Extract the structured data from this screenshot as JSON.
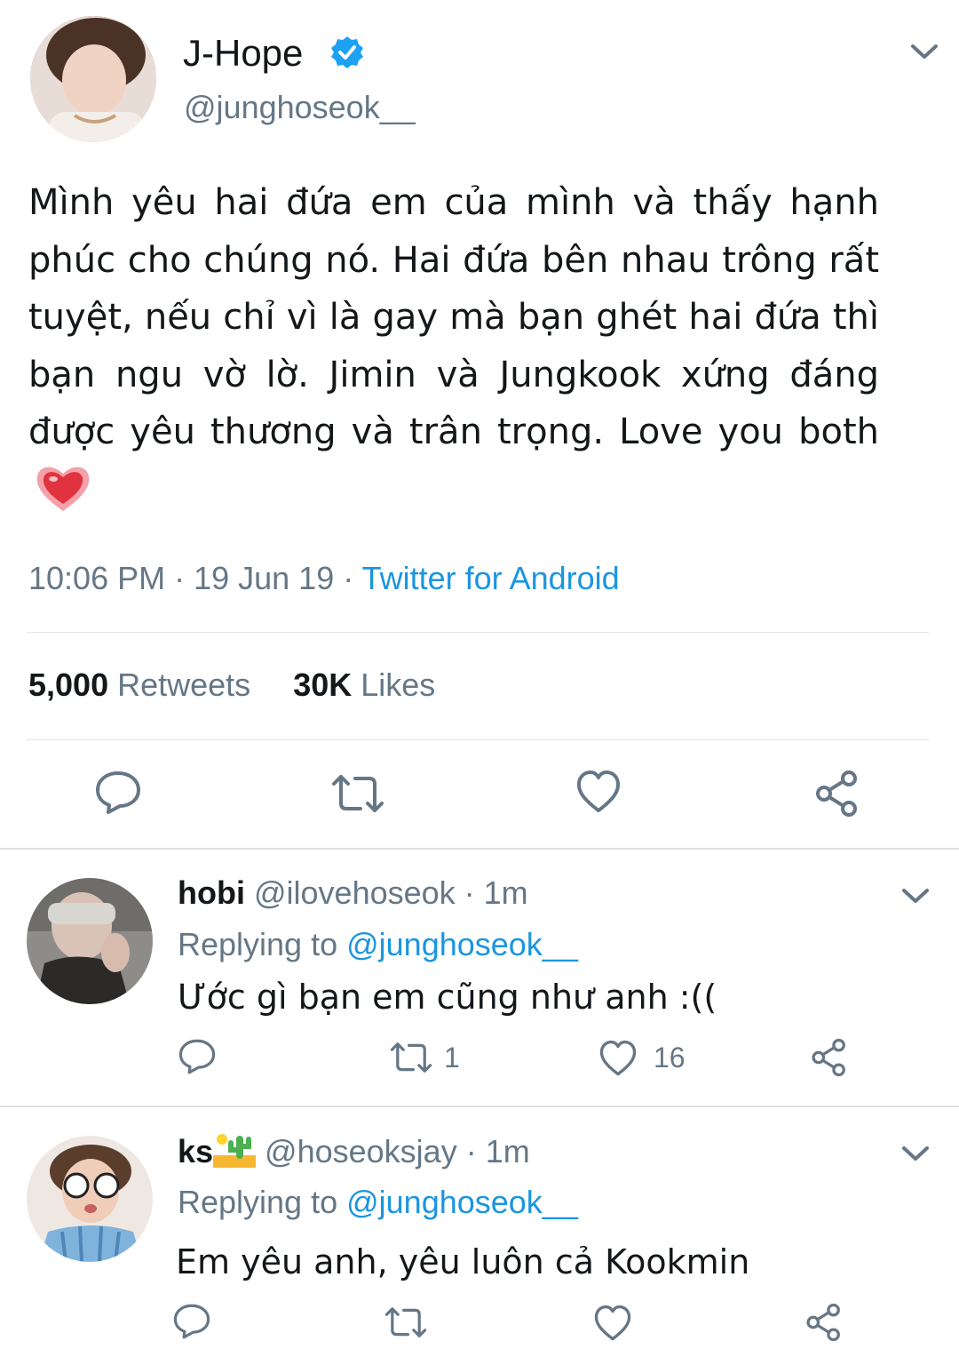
{
  "tweet": {
    "display_name": "J-Hope",
    "handle": "@junghoseok__",
    "verified": true,
    "text": "Mình yêu hai đứa em của mình và thấy hạnh phúc cho chúng nó. Hai đứa bên nhau trông rất tuyệt, nếu chỉ vì là gay mà bạn ghét hai đứa thì bạn ngu vờ lờ. Jimin và Jungkook xứng đáng được yêu thương và trân trọng. Love you both",
    "time": "10:06 PM",
    "sep1": " · ",
    "date": "19 Jun 19",
    "sep2": " · ",
    "source": "Twitter for Android",
    "retweets_count": "5,000",
    "retweets_label": " Retweets",
    "likes_count": "30K",
    "likes_label": " Likes"
  },
  "replies": [
    {
      "name": "hobi",
      "handle": " @ilovehoseok",
      "age": " · 1m",
      "replying_label": "Replying to ",
      "replying_to": "@junghoseok__",
      "text": "Ước gì bạn em cũng như anh :((",
      "retweets": "1",
      "likes": "16"
    },
    {
      "name": "ks",
      "handle": " @hoseoksjay",
      "age": " · 1m",
      "replying_label": "Replying to ",
      "replying_to": "@junghoseok__",
      "text": "Em yêu anh, yêu luôn cả Kookmin",
      "retweets": "",
      "likes": ""
    }
  ],
  "icons": {
    "verified": "verified-badge-icon",
    "caret": "chevron-down-icon",
    "reply": "reply-icon",
    "retweet": "retweet-icon",
    "like": "heart-icon",
    "share": "share-icon",
    "emoji_heart": "sparkling-heart-emoji",
    "emoji_cactus": "desert-cactus-emoji"
  },
  "colors": {
    "link": "#1b95e0",
    "muted": "#657786",
    "verified": "#1da1f2",
    "divider": "#dfe3e6"
  }
}
